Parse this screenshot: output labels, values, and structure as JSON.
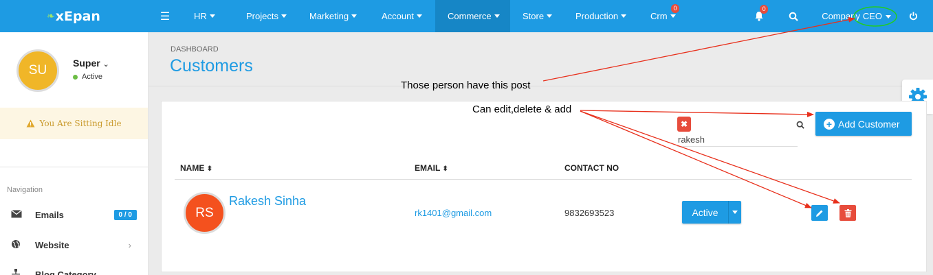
{
  "app": {
    "brand": "xEpan"
  },
  "topnav": {
    "items": [
      {
        "label": "HR"
      },
      {
        "label": "Projects"
      },
      {
        "label": "Marketing"
      },
      {
        "label": "Account"
      },
      {
        "label": "Commerce"
      },
      {
        "label": "Store"
      },
      {
        "label": "Production"
      },
      {
        "label": "Crm",
        "badge": "0"
      }
    ],
    "active": "Commerce",
    "notifications_badge": "0",
    "company_label": "Company",
    "post_label": "CEO"
  },
  "user": {
    "initials": "SU",
    "name": "Super",
    "status": "Active",
    "idle_message": "You Are Sitting Idle"
  },
  "sidebar": {
    "section_label": "Navigation",
    "items": [
      {
        "label": "Emails",
        "icon": "envelope-icon",
        "counter": "0 / 0"
      },
      {
        "label": "Website",
        "icon": "globe-icon"
      },
      {
        "label": "Blog Category",
        "icon": "sitemap-icon"
      }
    ]
  },
  "page": {
    "breadcrumb": "DASHBOARD",
    "title": "Customers"
  },
  "toolbar": {
    "search_value": "rakesh",
    "add_label": "Add Customer"
  },
  "table": {
    "columns": [
      "NAME",
      "EMAIL",
      "CONTACT NO"
    ],
    "rows": [
      {
        "initials": "RS",
        "name": "Rakesh Sinha",
        "email": "rk1401@gmail.com",
        "contact": "9832693523",
        "status": "Active"
      }
    ]
  },
  "annotations": {
    "note1": "Those person have this post",
    "note2": "Can edit,delete & add"
  },
  "colors": {
    "primary": "#1e9be3",
    "danger": "#e74c3c",
    "annotation": "#e8301c",
    "highlight": "#22cc22"
  }
}
